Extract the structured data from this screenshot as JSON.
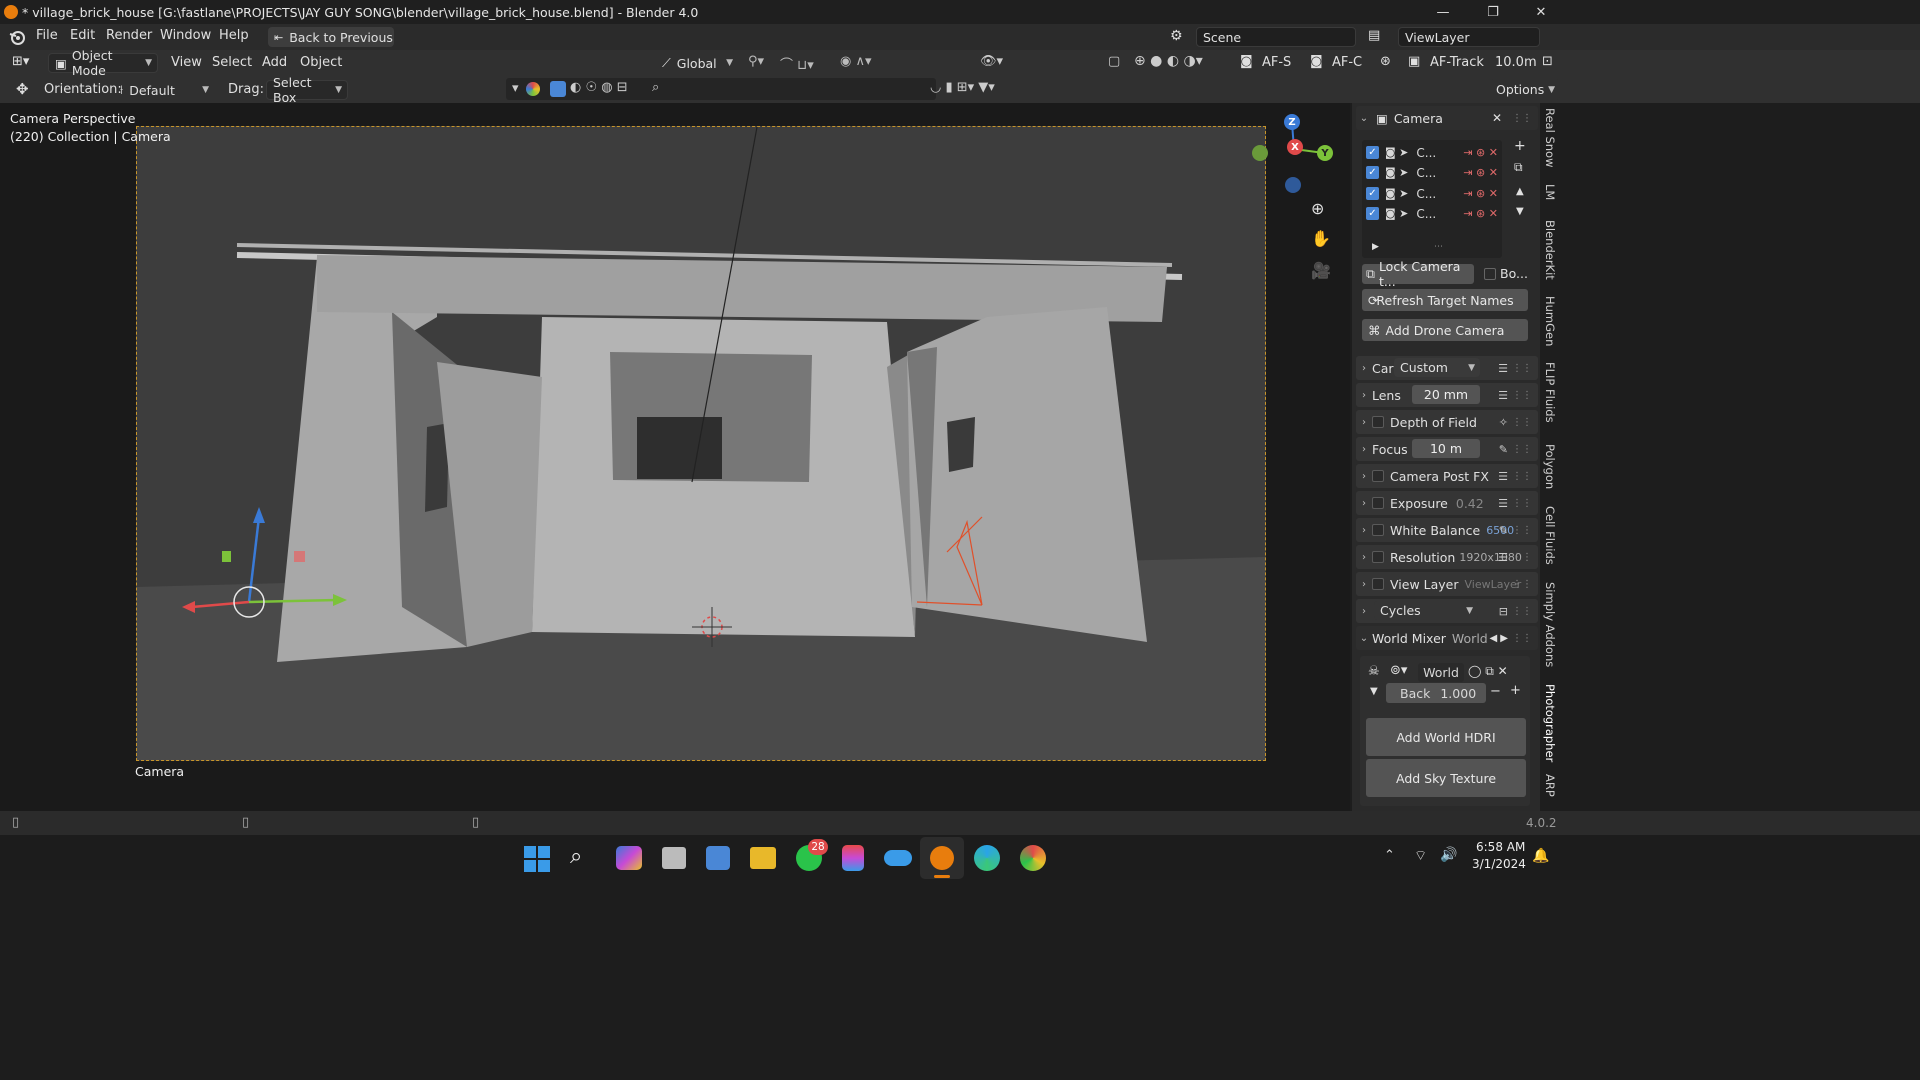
{
  "window": {
    "title": "* village_brick_house [G:\\fastlane\\PROJECTS\\JAY GUY SONG\\blender\\village_brick_house.blend] - Blender 4.0",
    "minimize": "—",
    "maximize": "❐",
    "close": "✕"
  },
  "menu": {
    "items": [
      "File",
      "Edit",
      "Render",
      "Window",
      "Help"
    ],
    "back_button": "Back to Previous",
    "scene": "Scene",
    "view_layer": "ViewLayer"
  },
  "header": {
    "mode": "Object Mode",
    "menus": [
      "View",
      "Select",
      "Add",
      "Object"
    ],
    "transform": "Global",
    "af_s": "AF-S",
    "af_c": "AF-C",
    "af_track": "AF-Track",
    "distance": "10.0m"
  },
  "toolrow": {
    "orientation_label": "Orientation:",
    "orientation_value": "Default",
    "drag_label": "Drag:",
    "drag_value": "Select Box",
    "options": "Options"
  },
  "viewport": {
    "perspective": "Camera Perspective",
    "collection": "(220) Collection | Camera",
    "camera_label": "Camera",
    "gizmo": {
      "z": "Z",
      "x": "X",
      "y": "Y"
    }
  },
  "npanel": {
    "header_title": "Camera",
    "camera_list": [
      "C...",
      "C...",
      "C...",
      "C..."
    ],
    "lock_camera": "Lock Camera t...",
    "bo": "Bo...",
    "refresh": "Refresh Target Names",
    "add_drone": "Add Drone Camera",
    "rows": {
      "car_label": "Car",
      "car_value": "Custom",
      "lens_label": "Lens",
      "lens_value": "20 mm",
      "dof_label": "Depth of Field",
      "focus_label": "Focus",
      "focus_value": "10 m",
      "post_fx": "Camera Post FX",
      "exposure_label": "Exposure",
      "exposure_value": "0.42",
      "white_balance_label": "White Balance",
      "white_balance_value": "6500",
      "resolution_label": "Resolution",
      "resolution_value": "1920x1080",
      "view_layer_label": "View Layer",
      "view_layer_value": "ViewLayer",
      "engine": "Cycles",
      "world_mixer": "World Mixer",
      "world_mixer_value": "World"
    },
    "world": {
      "name": "World",
      "back_label": "Back",
      "back_value": "1.000",
      "add_hdri": "Add World HDRI",
      "add_sky": "Add Sky Texture"
    }
  },
  "side_tabs": [
    "Real Snow",
    "LM",
    "BlenderKit",
    "HumGen",
    "FLIP Fluids",
    "Polygon",
    "Cell Fluids",
    "Simply Addons",
    "Photographer",
    "ARP"
  ],
  "statusbar": {
    "version": "4.0.2"
  },
  "taskbar": {
    "whatsapp_badge": "28",
    "time": "6:58 AM",
    "date": "3/1/2024"
  },
  "colors": {
    "accent": "#4a87d6",
    "camera_frame": "#c8952a",
    "blender_orange": "#e87d0d",
    "axis_x": "#e04a4a",
    "axis_y": "#7cc23a",
    "axis_z": "#3a7ad6"
  }
}
